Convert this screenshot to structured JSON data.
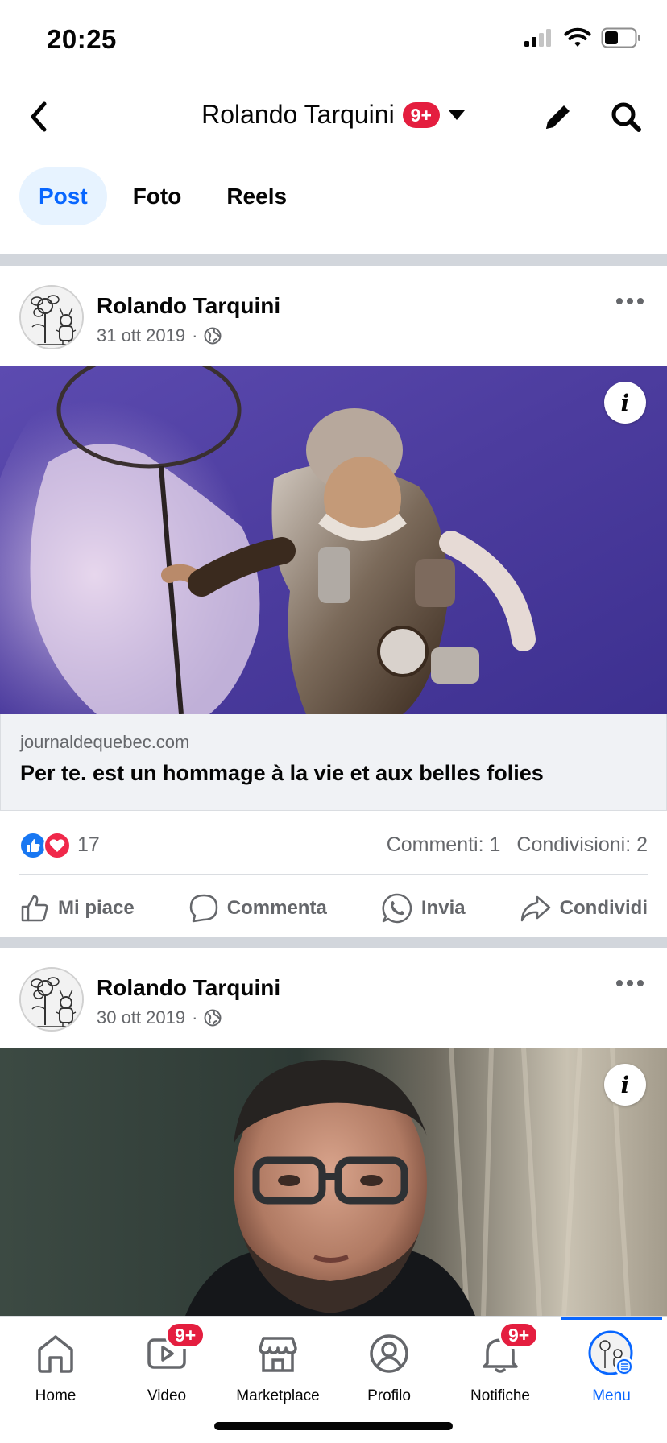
{
  "status": {
    "time": "20:25"
  },
  "header": {
    "title": "Rolando Tarquini",
    "badge": "9+"
  },
  "tabs": [
    {
      "label": "Post",
      "active": true
    },
    {
      "label": "Foto",
      "active": false
    },
    {
      "label": "Reels",
      "active": false
    }
  ],
  "posts": [
    {
      "author": "Rolando Tarquini",
      "date": "31 ott 2019",
      "dot": "·",
      "info_icon": "i",
      "link_domain": "journaldequebec.com",
      "link_title": "Per te. est un hommage à la vie et aux belles folies",
      "reaction_count": "17",
      "comments": "Commenti: 1",
      "shares": "Condivisioni: 2"
    },
    {
      "author": "Rolando Tarquini",
      "date": "30 ott 2019",
      "dot": "·",
      "info_icon": "i"
    }
  ],
  "actions": {
    "like": "Mi piace",
    "comment": "Commenta",
    "send": "Invia",
    "share": "Condividi"
  },
  "nav": {
    "home": "Home",
    "video": "Video",
    "video_badge": "9+",
    "marketplace": "Marketplace",
    "profile": "Profilo",
    "notifications": "Notifiche",
    "notifications_badge": "9+",
    "menu": "Menu"
  },
  "colors": {
    "accent": "#0866ff",
    "badge": "#e41e3f",
    "muted": "#65676b"
  }
}
